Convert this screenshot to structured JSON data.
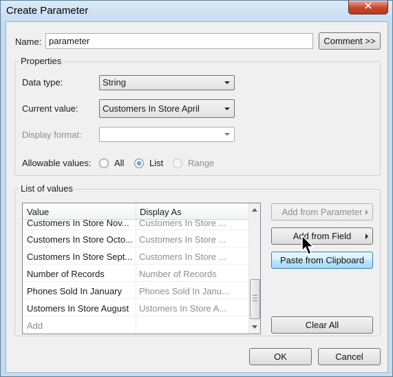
{
  "window": {
    "title": "Create Parameter",
    "close_glyph": "✕"
  },
  "name_row": {
    "label": "Name:",
    "value": "parameter",
    "comment_button": "Comment >>"
  },
  "properties": {
    "title": "Properties",
    "data_type": {
      "label": "Data type:",
      "value": "String"
    },
    "current_value": {
      "label": "Current value:",
      "value": "Customers In Store April"
    },
    "display_format": {
      "label": "Display format:",
      "value": ""
    },
    "allowable_values": {
      "label": "Allowable values:",
      "options": [
        {
          "label": "All",
          "checked": false,
          "disabled": false
        },
        {
          "label": "List",
          "checked": true,
          "disabled": false
        },
        {
          "label": "Range",
          "checked": false,
          "disabled": true
        }
      ]
    }
  },
  "list_of_values": {
    "title": "List of values",
    "columns": [
      "Value",
      "Display As"
    ],
    "rows": [
      {
        "value": "Customers In Store Nov...",
        "display": "Customers In Store ..."
      },
      {
        "value": "Customers In Store Octo...",
        "display": "Customers In Store ..."
      },
      {
        "value": "Customers In Store Sept...",
        "display": "Customers In Store ..."
      },
      {
        "value": "Number of Records",
        "display": "Number of Records"
      },
      {
        "value": "Phones Sold In January",
        "display": "Phones Sold In Janu..."
      },
      {
        "value": "Ustomers In Store August",
        "display": "Ustomers In Store A..."
      }
    ],
    "add_placeholder": "Add",
    "buttons": {
      "add_from_parameter": "Add from Parameter",
      "add_from_field": "Add from Field",
      "paste_from_clipboard": "Paste from Clipboard",
      "clear_all": "Clear All"
    }
  },
  "footer": {
    "ok": "OK",
    "cancel": "Cancel"
  }
}
